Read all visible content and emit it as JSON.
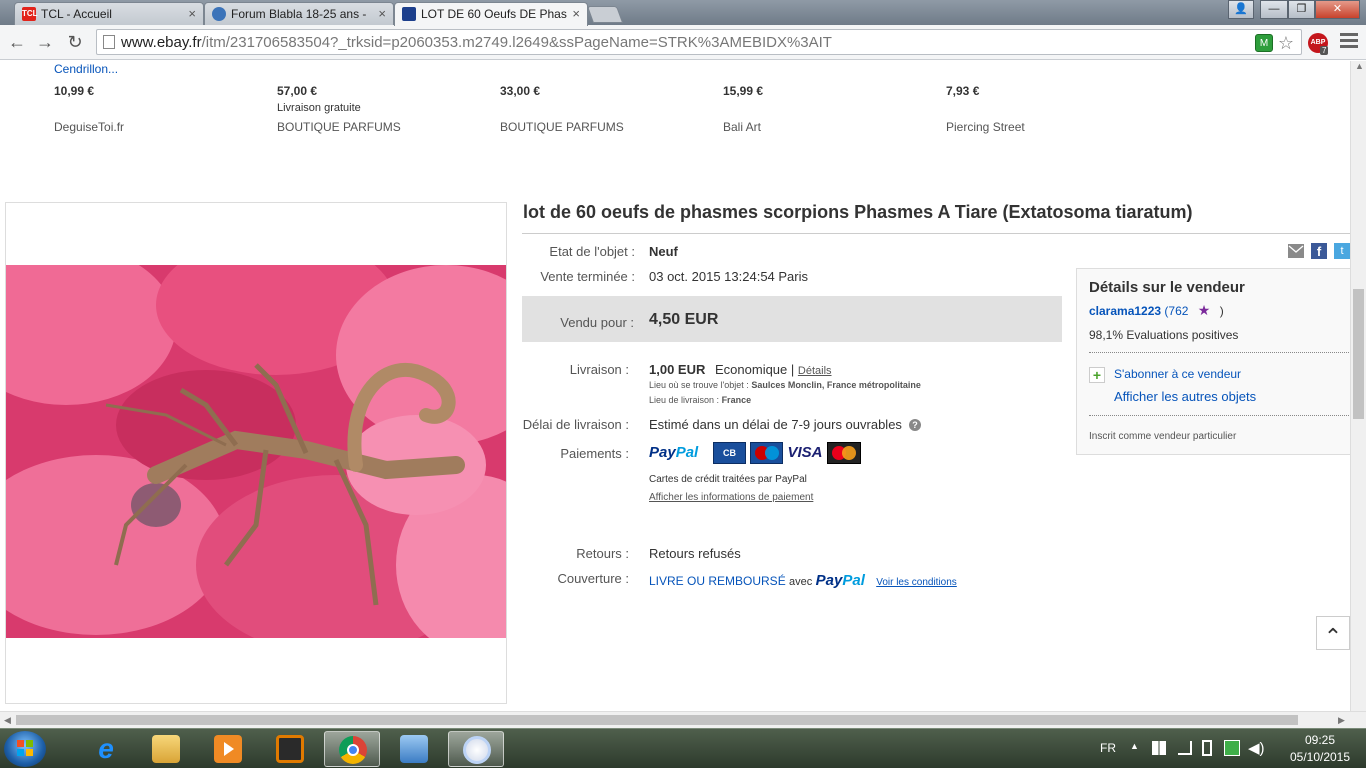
{
  "tabs": [
    {
      "title": "TCL - Accueil",
      "favicon_text": "TCL",
      "favicon_color": "#e2231a"
    },
    {
      "title": "Forum Blabla 18-25 ans -",
      "favicon_text": "",
      "favicon_color": "#3b73b9"
    },
    {
      "title": "LOT DE 60 Oeufs DE Phas",
      "favicon_text": "",
      "favicon_color": "#1c3f8c"
    }
  ],
  "tab_close": "×",
  "window_buttons": {
    "user": "👤",
    "minimize": "—",
    "maximize": "❐",
    "close": "✕"
  },
  "nav": {
    "back": "←",
    "forward": "→",
    "reload": "↻"
  },
  "url": {
    "host": "www.ebay.fr",
    "path": "/itm/231706583504?_trksid=p2060353.m2749.l2649&ssPageName=STRK%3AMEBIDX%3AIT"
  },
  "abp_label": "ABP",
  "abp_count": "7",
  "similar_items": [
    {
      "title": "Cendrillon...",
      "price": "10,99 €",
      "shipping": "",
      "seller": "DeguiseToi.fr"
    },
    {
      "title": "",
      "price": "57,00 €",
      "shipping": "Livraison gratuite",
      "seller": "BOUTIQUE PARFUMS"
    },
    {
      "title": "",
      "price": "33,00 €",
      "shipping": "",
      "seller": "BOUTIQUE PARFUMS"
    },
    {
      "title": "",
      "price": "15,99 €",
      "shipping": "",
      "seller": "Bali Art"
    },
    {
      "title": "",
      "price": "7,93 €",
      "shipping": "",
      "seller": "Piercing Street"
    }
  ],
  "item": {
    "title": "lot de 60 oeufs de phasmes scorpions Phasmes A Tiare (Extatosoma tiaratum)",
    "condition_label": "Etat de l'objet :",
    "condition": "Neuf",
    "ended_label": "Vente terminée :",
    "ended": "03 oct. 2015   13:24:54 Paris",
    "sold_label": "Vendu pour :",
    "sold_price": "4,50 EUR",
    "shipping_label": "Livraison :",
    "shipping_price": "1,00 EUR",
    "shipping_type": "Economique |",
    "shipping_details": "Détails",
    "location_label": "Lieu où se trouve l'objet :",
    "location": "Saulces Monclin, France métropolitaine",
    "ship_to_label": "Lieu de livraison :",
    "ship_to": "France",
    "delay_label": "Délai de livraison :",
    "delay": "Estimé dans un délai de 7-9 jours ouvrables",
    "payments_label": "Paiements :",
    "payments_note": "Cartes de crédit traitées par PayPal",
    "payments_link": "Afficher les informations de paiement",
    "returns_label": "Retours :",
    "returns": "Retours refusés",
    "coverage_label": "Couverture :",
    "coverage_text": "LIVRE OU REMBOURSÉ",
    "coverage_with": "avec",
    "coverage_link": "Voir les conditions",
    "paypal_logo": "PayPal",
    "card_logos": {
      "cb": "CB",
      "maestro": "Maestro",
      "visa": "VISA",
      "mastercard": "MasterCard"
    }
  },
  "seller": {
    "heading": "Détails sur le vendeur",
    "name": "clarama1223",
    "feedback_open": "(762",
    "feedback_close": ")",
    "positive": "98,1% Evaluations positives",
    "subscribe": "S'abonner à ce vendeur",
    "other_items": "Afficher les autres objets",
    "type": "Inscrit comme vendeur particulier"
  },
  "share_icons": [
    "email-icon",
    "facebook-icon",
    "twitter-icon"
  ],
  "back_to_top": "⌃",
  "taskbar": {
    "language": "FR",
    "time": "09:25",
    "date": "05/10/2015",
    "apps": [
      "internet-explorer",
      "file-explorer",
      "media-player",
      "filezilla",
      "chrome",
      "remote-desktop",
      "itunes"
    ]
  },
  "colors": {
    "link": "#0654ba",
    "paypal_dark": "#003087",
    "paypal_light": "#009cde",
    "price_band": "#e1e1e1"
  }
}
